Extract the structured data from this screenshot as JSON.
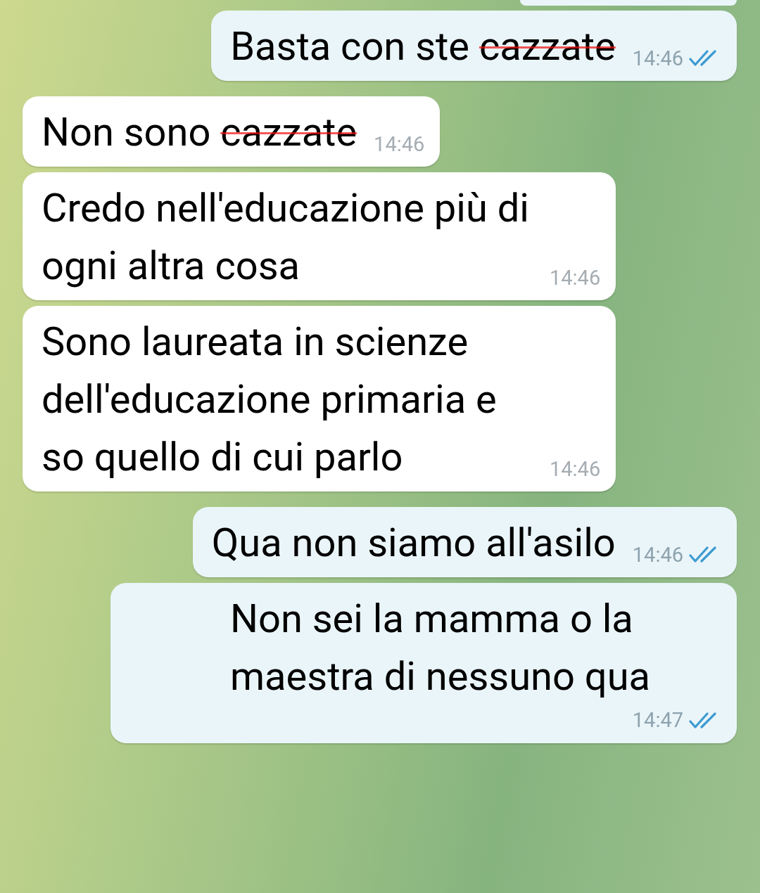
{
  "messages": [
    {
      "kind": "outgoing",
      "parts": [
        {
          "text": "Basta con ste ",
          "scribbled": false
        },
        {
          "text": "cazzate",
          "scribbled": true
        }
      ],
      "time": "14:46",
      "read": true
    },
    {
      "kind": "incoming",
      "parts": [
        {
          "text": "Non sono ",
          "scribbled": false
        },
        {
          "text": "cazzate",
          "scribbled": true
        }
      ],
      "time": "14:46"
    },
    {
      "kind": "incoming",
      "parts": [
        {
          "text": "Credo nell'educazione più di ogni altra cosa",
          "scribbled": false
        }
      ],
      "time": "14:46"
    },
    {
      "kind": "incoming",
      "parts": [
        {
          "text": "Sono laureata in scienze dell'educazione primaria e so quello di cui parlo",
          "scribbled": false
        }
      ],
      "time": "14:46"
    },
    {
      "kind": "outgoing",
      "parts": [
        {
          "text": "Qua non siamo all'asilo",
          "scribbled": false
        }
      ],
      "time": "14:46",
      "read": true
    },
    {
      "kind": "outgoing",
      "parts": [
        {
          "text": "Non sei la mamma o la maestra di nessuno qua",
          "scribbled": false
        }
      ],
      "time": "14:47",
      "read": true
    }
  ]
}
